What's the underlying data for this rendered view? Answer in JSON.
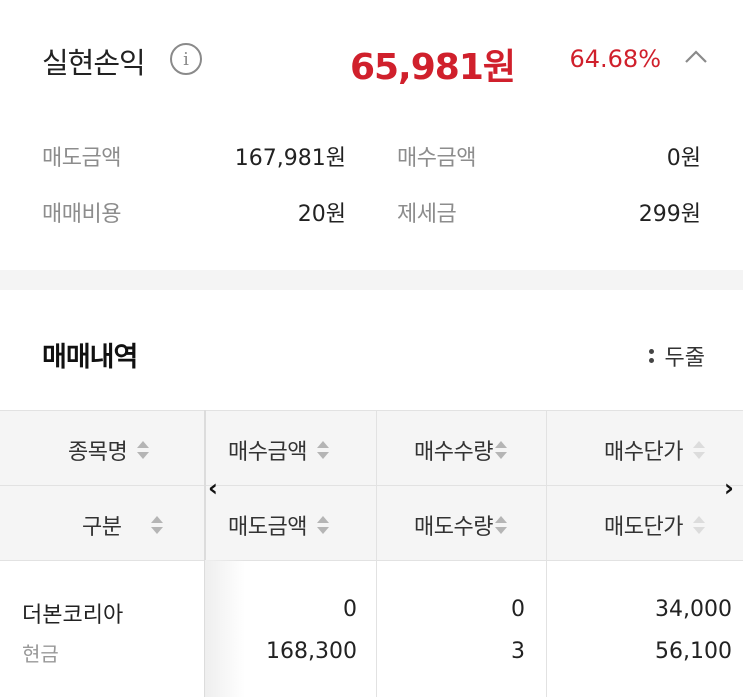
{
  "summary": {
    "title": "실현손익",
    "info_icon": "i",
    "profit": "65,981원",
    "rate": "64.68%",
    "rows": [
      {
        "label1": "매도금액",
        "value1": "167,981원",
        "label2": "매수금액",
        "value2": "0원"
      },
      {
        "label1": "매매비용",
        "value1": "20원",
        "label2": "제세금",
        "value2": "299원"
      }
    ]
  },
  "history": {
    "title": "매매내역",
    "view_option": "두줄"
  },
  "table": {
    "headers_top": [
      "종목명",
      "매수금액",
      "매수수량",
      "매수단가"
    ],
    "headers_bottom": [
      "구분",
      "매도금액",
      "매도수량",
      "매도단가"
    ],
    "rows": [
      {
        "name": "더본코리아",
        "type": "현금",
        "buy_amount": "0",
        "sell_amount": "168,300",
        "buy_qty": "0",
        "sell_qty": "3",
        "buy_price": "34,000",
        "sell_price": "56,100"
      }
    ]
  },
  "colors": {
    "profit": "#d0202c",
    "header_bg": "#f5f5f5"
  }
}
